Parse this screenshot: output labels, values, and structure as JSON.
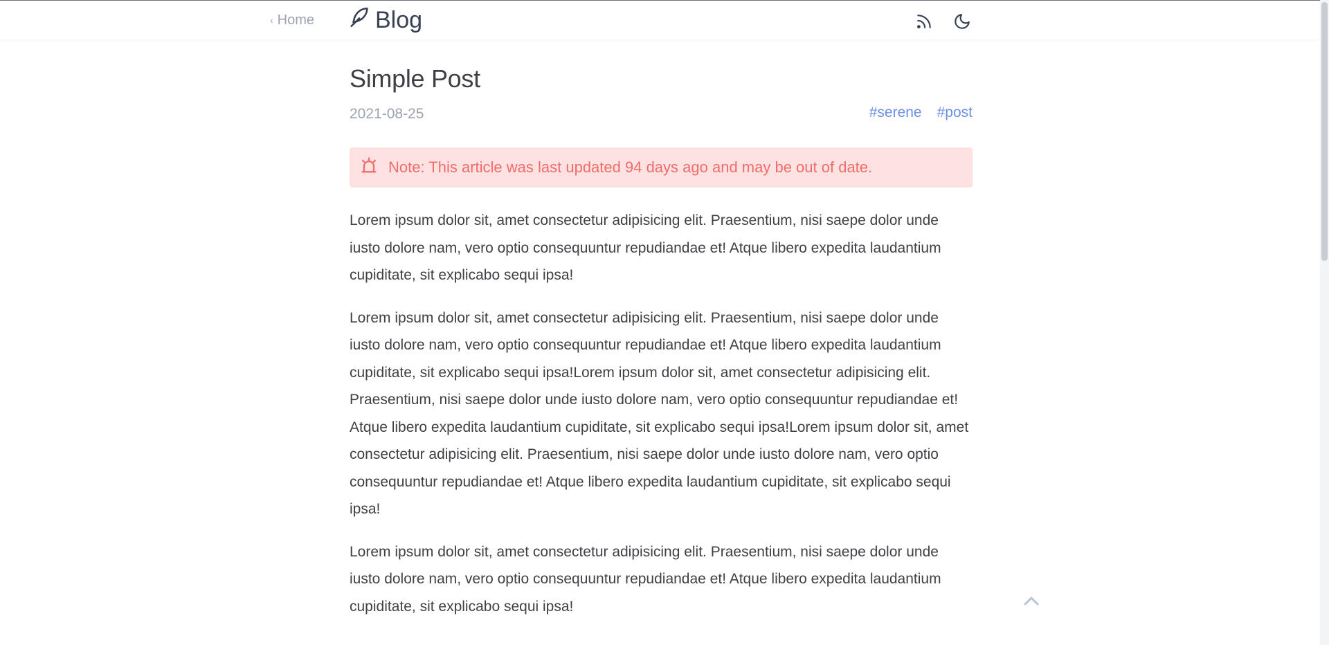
{
  "header": {
    "back_label": "Home",
    "brand_label": "Blog",
    "icons": [
      "chevron-left-icon",
      "feather-icon",
      "rss-icon",
      "moon-icon"
    ]
  },
  "post": {
    "title": "Simple Post",
    "date": "2021-08-25",
    "tags": [
      "serene",
      "post"
    ],
    "tag_prefix": "#",
    "notice": "Note: This article was last updated 94 days ago and may be out of date.",
    "paragraphs": [
      "Lorem ipsum dolor sit, amet consectetur adipisicing elit. Praesentium, nisi saepe dolor unde iusto dolore nam, vero optio consequuntur repudiandae et! Atque libero expedita laudantium cupiditate, sit explicabo sequi ipsa!",
      "Lorem ipsum dolor sit, amet consectetur adipisicing elit. Praesentium, nisi saepe dolor unde iusto dolore nam, vero optio consequuntur repudiandae et! Atque libero expedita laudantium cupiditate, sit explicabo sequi ipsa!Lorem ipsum dolor sit, amet consectetur adipisicing elit. Praesentium, nisi saepe dolor unde iusto dolore nam, vero optio consequuntur repudiandae et! Atque libero expedita laudantium cupiditate, sit explicabo sequi ipsa!Lorem ipsum dolor sit, amet consectetur adipisicing elit. Praesentium, nisi saepe dolor unde iusto dolore nam, vero optio consequuntur repudiandae et! Atque libero expedita laudantium cupiditate, sit explicabo sequi ipsa!",
      "Lorem ipsum dolor sit, amet consectetur adipisicing elit. Praesentium, nisi saepe dolor unde iusto dolore nam, vero optio consequuntur repudiandae et! Atque libero expedita laudantium cupiditate, sit explicabo sequi ipsa!"
    ]
  },
  "floating": {
    "icon": "chevron-up-icon"
  },
  "colors": {
    "tag": "#6b8fe8",
    "notice_bg": "#fee2e2",
    "notice_text": "#f26b6b",
    "muted": "#9ca3af",
    "text": "#3f3f46"
  }
}
